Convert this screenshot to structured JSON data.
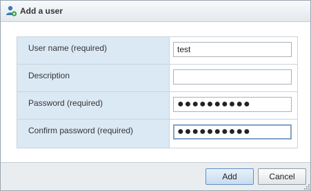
{
  "dialog": {
    "title": "Add a user",
    "title_icon": "add-user-icon"
  },
  "form": {
    "fields": [
      {
        "label": "User name (required)",
        "value": "test",
        "type": "text",
        "focused": false
      },
      {
        "label": "Description",
        "value": "",
        "type": "text",
        "focused": false
      },
      {
        "label": "Password (required)",
        "value": "●●●●●●●●●●",
        "type": "password",
        "focused": false
      },
      {
        "label": "Confirm password (required)",
        "value": "●●●●●●●●●●",
        "type": "password",
        "focused": true
      }
    ]
  },
  "footer": {
    "add_label": "Add",
    "cancel_label": "Cancel"
  },
  "colors": {
    "label_column_bg": "#dbe9f5",
    "footer_bg": "#e9edf0",
    "focus_border": "#7fa3c4"
  }
}
